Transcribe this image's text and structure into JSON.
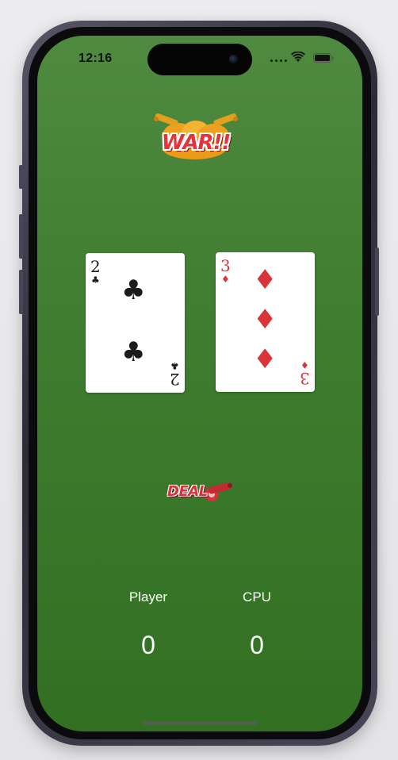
{
  "status_bar": {
    "time": "12:16",
    "icons": [
      "signal-dots-icon",
      "wifi-icon",
      "battery-icon"
    ]
  },
  "logo": {
    "text": "WAR!!",
    "icon": "cannons-logo-icon"
  },
  "cards": {
    "player": {
      "rank": "2",
      "suit": "♣",
      "suit_name": "clubs",
      "color": "#1b1b1b"
    },
    "cpu": {
      "rank": "3",
      "suit": "♦",
      "suit_name": "diamonds",
      "color": "#d9343a"
    }
  },
  "deal_button": {
    "label": "DEAL",
    "icon": "cannon-icon"
  },
  "scores": {
    "player_label": "Player",
    "player_value": "0",
    "cpu_label": "CPU",
    "cpu_value": "0"
  },
  "colors": {
    "table_green_top": "#4f8a40",
    "table_green_bottom": "#326f22",
    "accent_red": "#e5333b",
    "logo_orange": "#f0a020"
  }
}
